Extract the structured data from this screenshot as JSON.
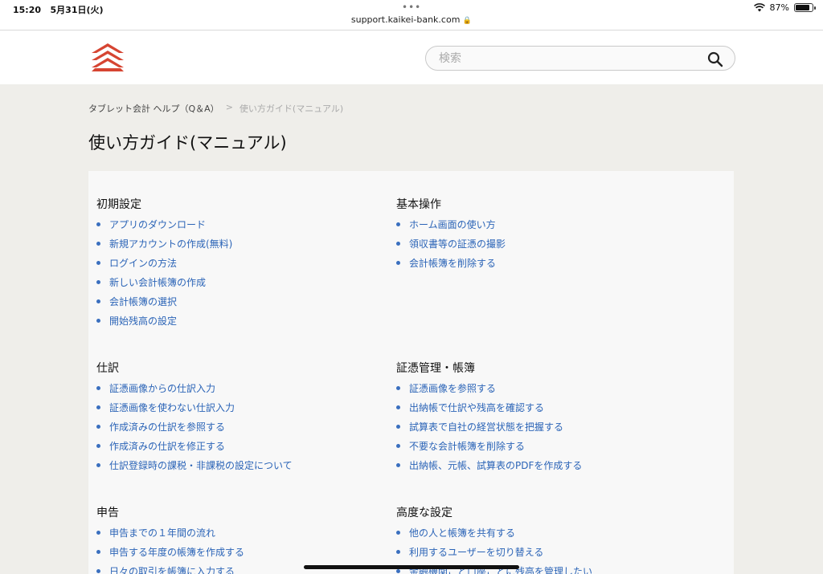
{
  "status_bar": {
    "time": "15:20",
    "date": "5月31日(火)",
    "url": "support.kaikei-bank.com",
    "battery": "87%",
    "battery_level": 0.87
  },
  "header": {
    "logo_icon": "red-chevron-stack-logo",
    "brand_color": "#d64532",
    "search_placeholder": "検索"
  },
  "breadcrumb": {
    "home": "タブレット会計 ヘルプ（Q＆A）",
    "separator": ">",
    "current": "使い方ガイド(マニュアル)"
  },
  "page_title": "使い方ガイド(マニュアル)",
  "sections": {
    "initial_setup": {
      "title": "初期設定",
      "links": [
        "アプリのダウンロード",
        "新規アカウントの作成(無料)",
        "ログインの方法",
        "新しい会計帳簿の作成",
        "会計帳簿の選択",
        "開始残高の設定"
      ]
    },
    "basic_ops": {
      "title": "基本操作",
      "links": [
        "ホーム画面の使い方",
        "領収書等の証憑の撮影",
        "会計帳簿を削除する"
      ]
    },
    "journal": {
      "title": "仕訳",
      "links": [
        "証憑画像からの仕訳入力",
        "証憑画像を使わない仕訳入力",
        "作成済みの仕訳を参照する",
        "作成済みの仕訳を修正する",
        "仕訳登録時の課税・非課税の設定について"
      ]
    },
    "voucher_mgmt": {
      "title": "証憑管理・帳簿",
      "links": [
        "証憑画像を参照する",
        "出納帳で仕訳や残高を確認する",
        "試算表で自社の経営状態を把握する",
        "不要な会計帳簿を削除する",
        "出納帳、元帳、試算表のPDFを作成する"
      ]
    },
    "tax_filing": {
      "title": "申告",
      "links": [
        "申告までの１年間の流れ",
        "申告する年度の帳簿を作成する",
        "日々の取引を帳簿に入力する"
      ]
    },
    "advanced": {
      "title": "高度な設定",
      "links": [
        "他の人と帳簿を共有する",
        "利用するユーザーを切り替える",
        "金融機関ごと口座ごとに残高を管理したい"
      ]
    }
  }
}
